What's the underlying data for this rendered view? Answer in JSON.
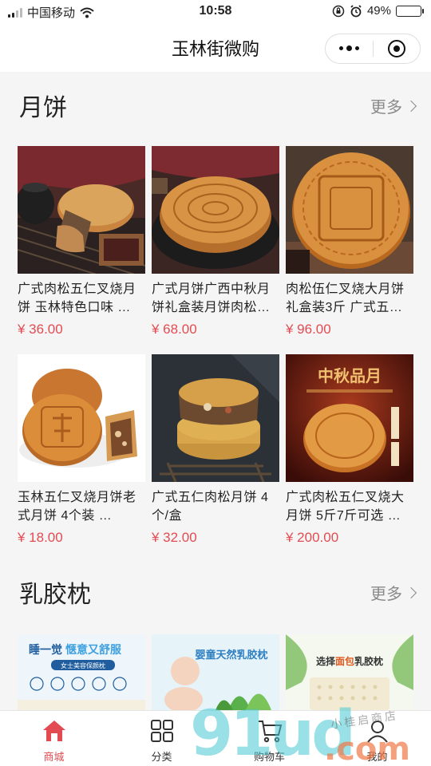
{
  "status_bar": {
    "carrier": "中国移动",
    "time": "10:58",
    "battery": "49%",
    "battery_level": 0.49
  },
  "nav": {
    "title": "玉林街微购"
  },
  "sections": [
    {
      "title": "月饼",
      "more_label": "更多",
      "products": [
        {
          "title": "广式肉松五仁叉烧月饼 玉林特色口味 …",
          "price": "¥ 36.00"
        },
        {
          "title": "广式月饼广西中秋月饼礼盒装月饼肉松…",
          "price": "¥ 68.00"
        },
        {
          "title": "肉松伍仁叉烧大月饼礼盒装3斤 广式五…",
          "price": "¥ 96.00"
        },
        {
          "title": "玉林五仁叉烧月饼老式月饼 4个装 …",
          "price": "¥ 18.00"
        },
        {
          "title": "广式五仁肉松月饼 4个/盒",
          "price": "¥ 32.00"
        },
        {
          "title": "广式肉松五仁叉烧大月饼 5斤7斤可选 …",
          "price": "¥ 200.00"
        }
      ],
      "image_text": {
        "p6_banner": "中秋品月"
      }
    },
    {
      "title": "乳胶枕",
      "more_label": "更多",
      "banners": [
        {
          "headline_a": "睡一觉",
          "headline_b": "惬意又舒服",
          "sub": "女士美容保颜枕"
        },
        {
          "headline": "婴童天然乳胶枕"
        },
        {
          "headline_a": "选择",
          "headline_b": "面包",
          "headline_c": "乳胶枕"
        }
      ]
    }
  ],
  "tabs": [
    {
      "label": "商城",
      "icon": "home-icon",
      "active": true
    },
    {
      "label": "分类",
      "icon": "grid-icon",
      "active": false
    },
    {
      "label": "购物车",
      "icon": "cart-icon",
      "active": false
    },
    {
      "label": "我的",
      "icon": "user-icon",
      "active": false
    }
  ],
  "watermark": {
    "digits": "91ud",
    "domain": ".com",
    "shop": "小桂启商店"
  },
  "colors": {
    "accent": "#e24b52",
    "watermark_teal": "#46c8d2",
    "watermark_orange": "#f07846"
  }
}
